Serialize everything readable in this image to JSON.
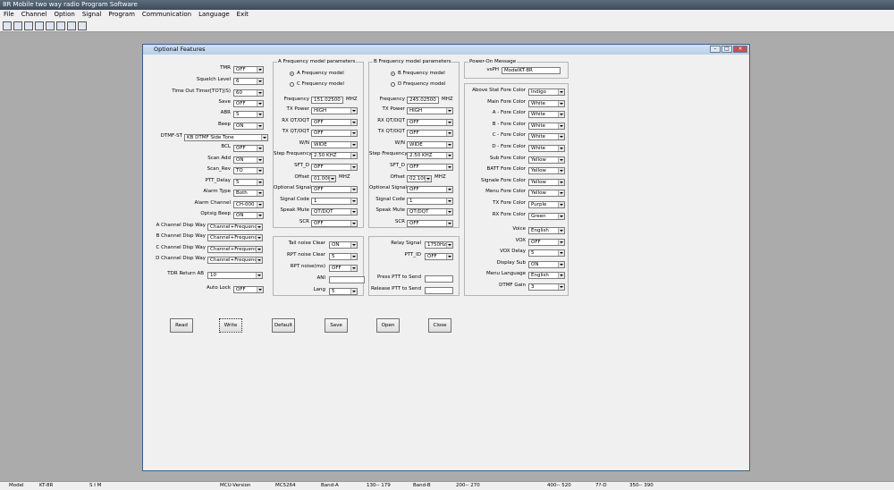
{
  "window": {
    "title": "8R  Mobile two way radio Program Software"
  },
  "menu": [
    "File",
    "Channel",
    "Option",
    "Signal",
    "Program",
    "Communication",
    "Language",
    "Exit"
  ],
  "dialog": {
    "title": "Optional Features"
  },
  "left": [
    {
      "label": "TMR",
      "value": "OFF",
      "type": "select"
    },
    {
      "label": "Squelch Level",
      "value": "6",
      "type": "select"
    },
    {
      "label": "Time Out Timer[TOT](S)",
      "value": "60",
      "type": "select"
    },
    {
      "label": "Save",
      "value": "OFF",
      "type": "select"
    },
    {
      "label": "ABR",
      "value": "5",
      "type": "select"
    },
    {
      "label": "Beep",
      "value": "ON",
      "type": "select"
    },
    {
      "label": "DTMF-ST",
      "value": "KB DTMF Side Tone",
      "type": "select"
    },
    {
      "label": "BCL",
      "value": "OFF",
      "type": "select"
    },
    {
      "label": "Scan Add",
      "value": "ON",
      "type": "select"
    },
    {
      "label": "Scan_Rev",
      "value": "TO",
      "type": "select"
    },
    {
      "label": "PTT_Delay",
      "value": "5",
      "type": "select"
    },
    {
      "label": "Alarm Type",
      "value": "Both",
      "type": "select"
    },
    {
      "label": "Alarm Channel",
      "value": "CH-000",
      "type": "select"
    },
    {
      "label": "Optsig Beep",
      "value": "ON",
      "type": "select"
    },
    {
      "label": "A Channel Disp Way",
      "value": "Channel+Frequency",
      "type": "select"
    },
    {
      "label": "B Channel Disp Way",
      "value": "Channel+Frequency",
      "type": "select"
    },
    {
      "label": "C Channel Disp Way",
      "value": "Channel+Frequency",
      "type": "select"
    },
    {
      "label": "D Channel Disp Way",
      "value": "Channel+Frequency",
      "type": "select"
    },
    {
      "label": "TDR Return AB",
      "value": "10",
      "type": "select"
    },
    {
      "label": "Auto Lock",
      "value": "OFF",
      "type": "select"
    }
  ],
  "groupA": {
    "title": "A Frequency model parameters",
    "radio1": "A Frequency model",
    "radio2": "C Frequency model",
    "freq_label": "Frequency",
    "freq": "151.02500",
    "unit": "MHZ",
    "fields": [
      {
        "label": "TX Power",
        "value": "HIGH"
      },
      {
        "label": "RX QT/DQT",
        "value": "OFF"
      },
      {
        "label": "TX QT/DQT",
        "value": "OFF"
      },
      {
        "label": "W/N",
        "value": "WIDE"
      },
      {
        "label": "Step Frequency",
        "value": "2.50 KHZ"
      },
      {
        "label": "SFT_D",
        "value": "OFF"
      },
      {
        "label": "Offset",
        "value": "01.000M",
        "unit": "MHZ"
      },
      {
        "label": "Optional Signal",
        "value": "OFF"
      },
      {
        "label": "Signal Code",
        "value": "1"
      },
      {
        "label": "Speak Mute",
        "value": "QT/DQT"
      },
      {
        "label": "SCR",
        "value": "OFF"
      }
    ]
  },
  "groupB": {
    "title": "B Frequency model parameters",
    "radio1": "B Frequency model",
    "radio2": "D Frequency model",
    "freq_label": "Frequency",
    "freq": "245.02500",
    "unit": "MHZ",
    "fields": [
      {
        "label": "TX Power",
        "value": "HIGH"
      },
      {
        "label": "RX QT/DQT",
        "value": "OFF"
      },
      {
        "label": "TX QT/DQT",
        "value": "OFF"
      },
      {
        "label": "W/N",
        "value": "WIDE"
      },
      {
        "label": "Step Frequency",
        "value": "2.50 KHZ"
      },
      {
        "label": "SFT_D",
        "value": "OFF"
      },
      {
        "label": "Offset",
        "value": "02.100M",
        "unit": "MHZ"
      },
      {
        "label": "Optional Signal",
        "value": "OFF"
      },
      {
        "label": "Signal Code",
        "value": "1"
      },
      {
        "label": "Speak Mute",
        "value": "QT/DQT"
      },
      {
        "label": "SCR",
        "value": "OFF"
      }
    ]
  },
  "noise": [
    {
      "label": "Tail noise Clear",
      "value": "ON",
      "type": "select"
    },
    {
      "label": "RPT noise Clear",
      "value": "5",
      "type": "select"
    },
    {
      "label": "RPT noise(ms)",
      "value": "OFF",
      "type": "select"
    },
    {
      "label": "ANI",
      "value": "",
      "type": "input"
    },
    {
      "label": "Lang",
      "value": "5",
      "type": "select"
    }
  ],
  "relay": [
    {
      "label": "Relay Signal",
      "value": "1750Hz",
      "type": "select"
    },
    {
      "label": "PTT_ID",
      "value": "OFF",
      "type": "select"
    },
    {
      "label": "Press PTT to Send",
      "value": "",
      "type": "input"
    },
    {
      "label": "Release PTT to Send",
      "value": "",
      "type": "input"
    }
  ],
  "poweron": {
    "title": "Power-On Message",
    "label": "vsPH",
    "value": "ModelKT-8R"
  },
  "colors": [
    {
      "label": "Above Stat Fore Color",
      "value": "Indigo"
    },
    {
      "label": "Main Fore Color",
      "value": "White"
    },
    {
      "label": "A - Fore Color",
      "value": "White"
    },
    {
      "label": "B - Fore Color",
      "value": "White"
    },
    {
      "label": "C - Fore Color",
      "value": "White"
    },
    {
      "label": "D - Fore Color",
      "value": "White"
    },
    {
      "label": "Sub Fore Color",
      "value": "Yellow"
    },
    {
      "label": "BATT Fore Color",
      "value": "Yellow"
    },
    {
      "label": "Signale Fore Color",
      "value": "Yellow"
    },
    {
      "label": "Menu Fore Color",
      "value": "Yellow"
    },
    {
      "label": "TX Fore Color",
      "value": "Purple"
    },
    {
      "label": "RX Fore Color",
      "value": "Green"
    },
    {
      "label": "Voice",
      "value": "English"
    },
    {
      "label": "VOX",
      "value": "OFF"
    },
    {
      "label": "VOX Delay",
      "value": "5"
    },
    {
      "label": "Display Sub",
      "value": "ON"
    },
    {
      "label": "Menu Language",
      "value": "English"
    },
    {
      "label": "DTMF Gain",
      "value": "3"
    }
  ],
  "buttons": [
    "Read",
    "Write",
    "Default",
    "Save",
    "Open",
    "Close"
  ],
  "status": [
    {
      "text": "Model"
    },
    {
      "text": "KT-8R"
    },
    {
      "text": "S I M"
    },
    {
      "text": "MCU-Version"
    },
    {
      "text": "MC5264"
    },
    {
      "text": "Band-A"
    },
    {
      "text": "130-- 179"
    },
    {
      "text": "Band-B"
    },
    {
      "text": "200-- 270"
    },
    {
      "text": "400-- 520"
    },
    {
      "text": "7?-D"
    },
    {
      "text": "350-- 390"
    }
  ]
}
